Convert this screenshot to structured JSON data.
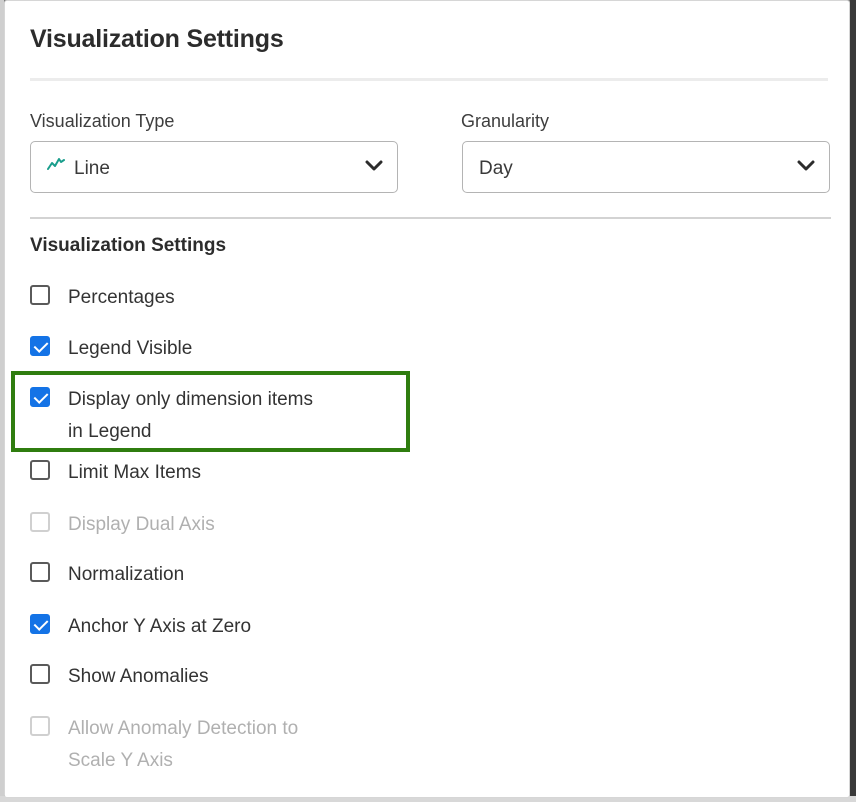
{
  "dialog": {
    "title": "Visualization Settings"
  },
  "visualization_type": {
    "label": "Visualization Type",
    "value": "Line",
    "icon": "line-chart-icon"
  },
  "granularity": {
    "label": "Granularity",
    "value": "Day"
  },
  "settings": {
    "title": "Visualization Settings",
    "options": [
      {
        "label": "Percentages",
        "checked": false,
        "disabled": false
      },
      {
        "label": "Legend Visible",
        "checked": true,
        "disabled": false
      },
      {
        "label_line1": "Display only dimension items",
        "label_line2": "in Legend",
        "checked": true,
        "disabled": false,
        "highlighted": true
      },
      {
        "label": "Limit Max Items",
        "checked": false,
        "disabled": false
      },
      {
        "label": "Display Dual Axis",
        "checked": false,
        "disabled": true
      },
      {
        "label": "Normalization",
        "checked": false,
        "disabled": false
      },
      {
        "label": "Anchor Y Axis at Zero",
        "checked": true,
        "disabled": false
      },
      {
        "label": "Show Anomalies",
        "checked": false,
        "disabled": false
      },
      {
        "label_line1": "Allow Anomaly Detection to",
        "label_line2": "Scale Y Axis",
        "checked": false,
        "disabled": true
      }
    ]
  },
  "colors": {
    "accent": "#1473e6",
    "highlight": "#2f7d0f",
    "icon_teal": "#1a9e8c"
  }
}
